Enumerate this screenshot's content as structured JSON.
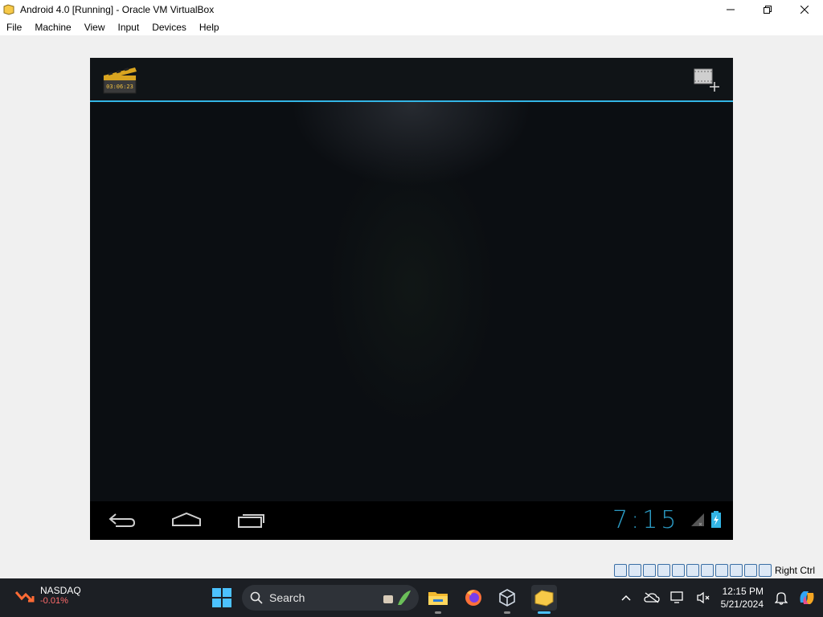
{
  "window": {
    "title": "Android 4.0 [Running] - Oracle VM VirtualBox"
  },
  "menu": [
    "File",
    "Machine",
    "View",
    "Input",
    "Devices",
    "Help"
  ],
  "android": {
    "clock": "7:15",
    "accent_color": "#33b5e5",
    "action_bar_icons": [
      "video-clapper-icon",
      "add-video-icon"
    ],
    "nav_buttons": [
      "back-icon",
      "home-icon",
      "recent-apps-icon"
    ]
  },
  "vbox_status": {
    "host_key": "Right Ctrl"
  },
  "taskbar": {
    "ticker_name": "NASDAQ",
    "ticker_change": "-0.01%",
    "search_placeholder": "Search",
    "time": "12:15 PM",
    "date": "5/21/2024"
  }
}
